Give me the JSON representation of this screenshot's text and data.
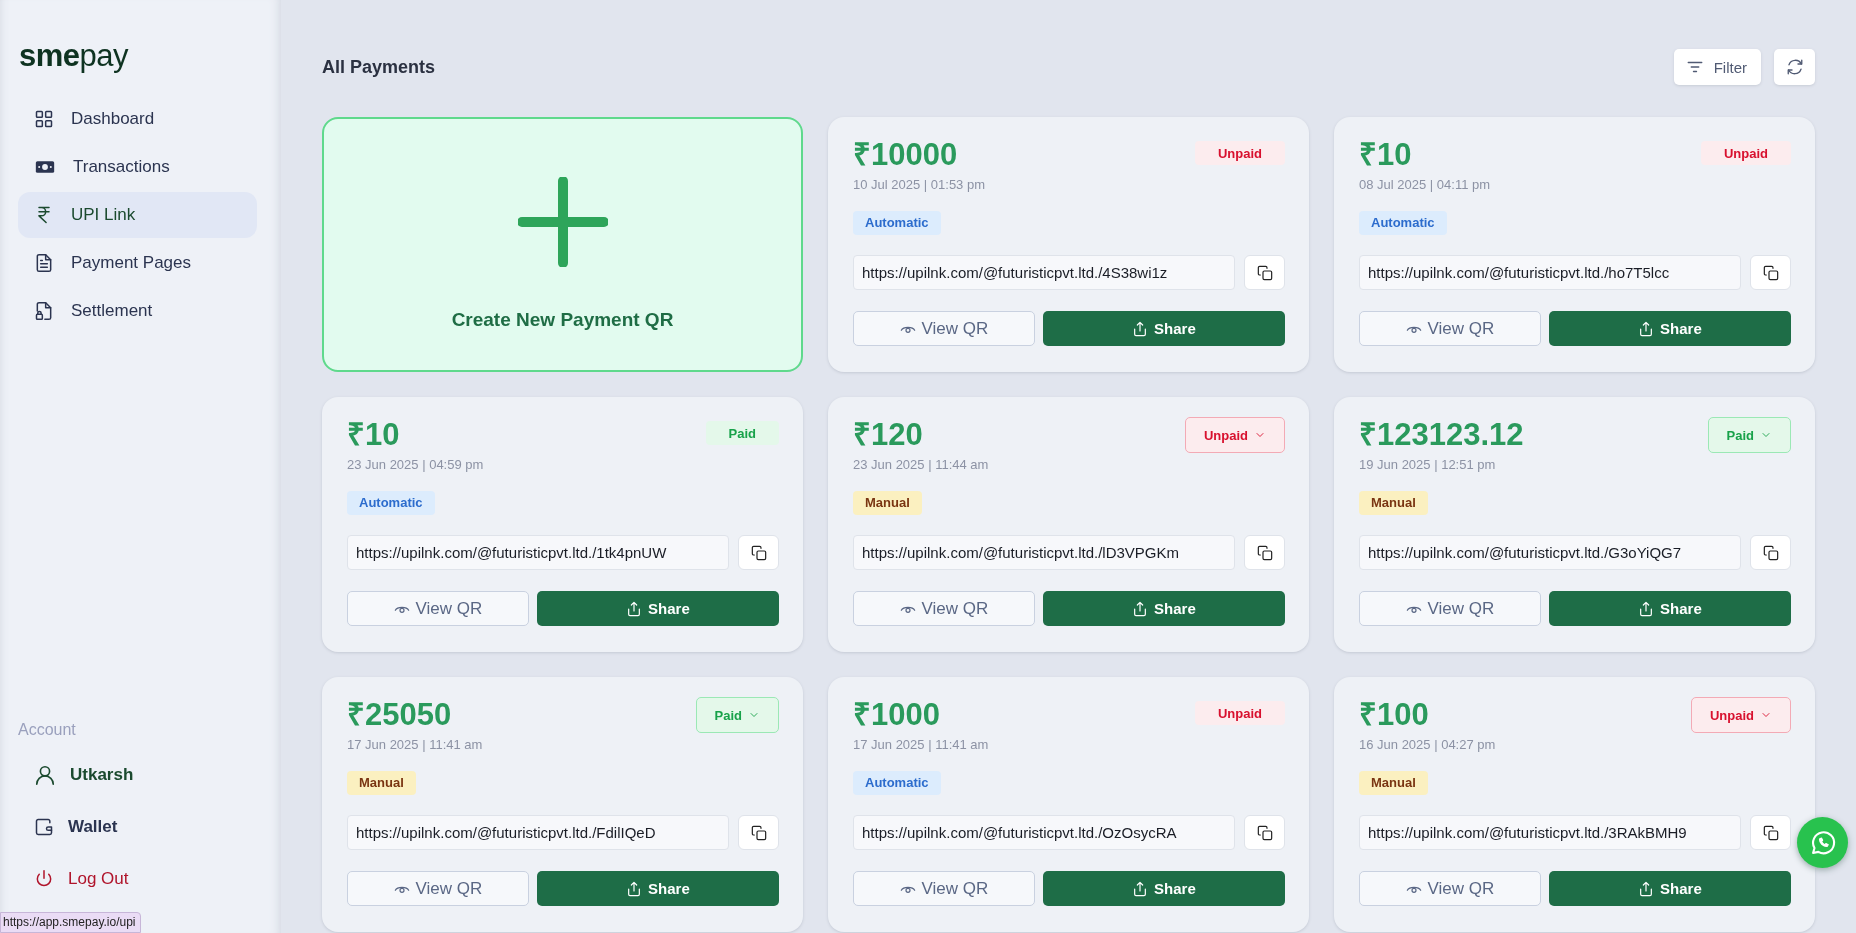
{
  "sidebar": {
    "logo": "**sme**pay",
    "nav": [
      {
        "label": "Dashboard",
        "selected": false
      },
      {
        "label": "Transactions",
        "selected": false
      },
      {
        "label": "UPI Link",
        "selected": true
      },
      {
        "label": "Payment Pages",
        "selected": false
      },
      {
        "label": "Settlement",
        "selected": false
      }
    ],
    "account": {
      "heading": "Account",
      "items": [
        {
          "label": "Utkarsh",
          "kind": "profile"
        },
        {
          "label": "Wallet",
          "kind": "plain"
        },
        {
          "label": "Log Out",
          "kind": "danger"
        }
      ]
    }
  },
  "main": {
    "title": "All Payments",
    "filter_label": "Filter",
    "create_label": "Create New Payment QR",
    "cards": [
      {
        "amount": "₹10000",
        "date": "10 Jul 2025 | 01:53 pm",
        "status": {
          "label": "Unpaid",
          "kind": "unpaid",
          "dropdown": false
        },
        "mode": {
          "label": "Automatic",
          "kind": "automatic"
        },
        "url": "https://upilnk.com/@futuristicpvt.ltd./4S38wi1z",
        "view_label": "View QR",
        "share_label": "Share"
      },
      {
        "amount": "₹10",
        "date": "08 Jul 2025 | 04:11 pm",
        "status": {
          "label": "Unpaid",
          "kind": "unpaid",
          "dropdown": false
        },
        "mode": {
          "label": "Automatic",
          "kind": "automatic"
        },
        "url": "https://upilnk.com/@futuristicpvt.ltd./ho7T5lcc",
        "view_label": "View QR",
        "share_label": "Share"
      },
      {
        "amount": "₹10",
        "date": "23 Jun 2025 | 04:59 pm",
        "status": {
          "label": "Paid",
          "kind": "paid",
          "dropdown": false
        },
        "mode": {
          "label": "Automatic",
          "kind": "automatic"
        },
        "url": "https://upilnk.com/@futuristicpvt.ltd./1tk4pnUW",
        "view_label": "View QR",
        "share_label": "Share"
      },
      {
        "amount": "₹120",
        "date": "23 Jun 2025 | 11:44 am",
        "status": {
          "label": "Unpaid",
          "kind": "unpaid",
          "dropdown": true
        },
        "mode": {
          "label": "Manual",
          "kind": "manual"
        },
        "url": "https://upilnk.com/@futuristicpvt.ltd./lD3VPGKm",
        "view_label": "View QR",
        "share_label": "Share"
      },
      {
        "amount": "₹123123.12",
        "date": "19 Jun 2025 | 12:51 pm",
        "status": {
          "label": "Paid",
          "kind": "paid",
          "dropdown": true
        },
        "mode": {
          "label": "Manual",
          "kind": "manual"
        },
        "url": "https://upilnk.com/@futuristicpvt.ltd./G3oYiQG7",
        "view_label": "View QR",
        "share_label": "Share"
      },
      {
        "amount": "₹25050",
        "date": "17 Jun 2025 | 11:41 am",
        "status": {
          "label": "Paid",
          "kind": "paid",
          "dropdown": true
        },
        "mode": {
          "label": "Manual",
          "kind": "manual"
        },
        "url": "https://upilnk.com/@futuristicpvt.ltd./FdilIQeD",
        "view_label": "View QR",
        "share_label": "Share"
      },
      {
        "amount": "₹1000",
        "date": "17 Jun 2025 | 11:41 am",
        "status": {
          "label": "Unpaid",
          "kind": "unpaid",
          "dropdown": false
        },
        "mode": {
          "label": "Automatic",
          "kind": "automatic"
        },
        "url": "https://upilnk.com/@futuristicpvt.ltd./OzOsycRA",
        "view_label": "View QR",
        "share_label": "Share"
      },
      {
        "amount": "₹100",
        "date": "16 Jun 2025 | 04:27 pm",
        "status": {
          "label": "Unpaid",
          "kind": "unpaid",
          "dropdown": true
        },
        "mode": {
          "label": "Manual",
          "kind": "manual"
        },
        "url": "https://upilnk.com/@futuristicpvt.ltd./3RAkBMH9",
        "view_label": "View QR",
        "share_label": "Share"
      }
    ]
  },
  "status_bar": "https://app.smepay.io/upi"
}
